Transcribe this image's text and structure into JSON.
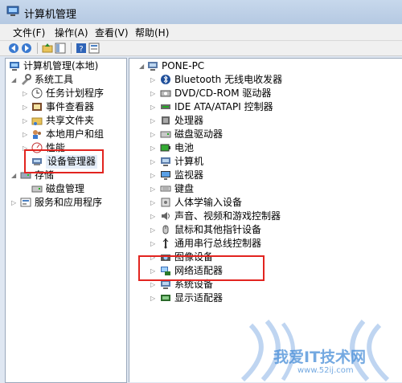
{
  "window": {
    "title": "计算机管理"
  },
  "menu": [
    "文件(F)",
    "操作(A)",
    "查看(V)",
    "帮助(H)"
  ],
  "left_tree": {
    "root": "计算机管理(本地)",
    "items": [
      "系统工具",
      "任务计划程序",
      "事件查看器",
      "共享文件夹",
      "本地用户和组",
      "性能",
      "设备管理器",
      "存储",
      "磁盘管理",
      "服务和应用程序"
    ]
  },
  "device_tree": {
    "root": "PONE-PC",
    "categories": [
      "Bluetooth 无线电收发器",
      "DVD/CD-ROM 驱动器",
      "IDE ATA/ATAPI 控制器",
      "处理器",
      "磁盘驱动器",
      "电池",
      "计算机",
      "监视器",
      "键盘",
      "人体学输入设备",
      "声音、视频和游戏控制器",
      "鼠标和其他指针设备",
      "通用串行总线控制器",
      "图像设备",
      "网络适配器",
      "系统设备",
      "显示适配器"
    ]
  },
  "watermark": {
    "text": "我爱IT技术网",
    "url": "www.52ij.com"
  },
  "colors": {
    "highlight_border": "#e2241f",
    "title_bar": "#c7d8ec",
    "pane_border": "#9aa8bb"
  }
}
